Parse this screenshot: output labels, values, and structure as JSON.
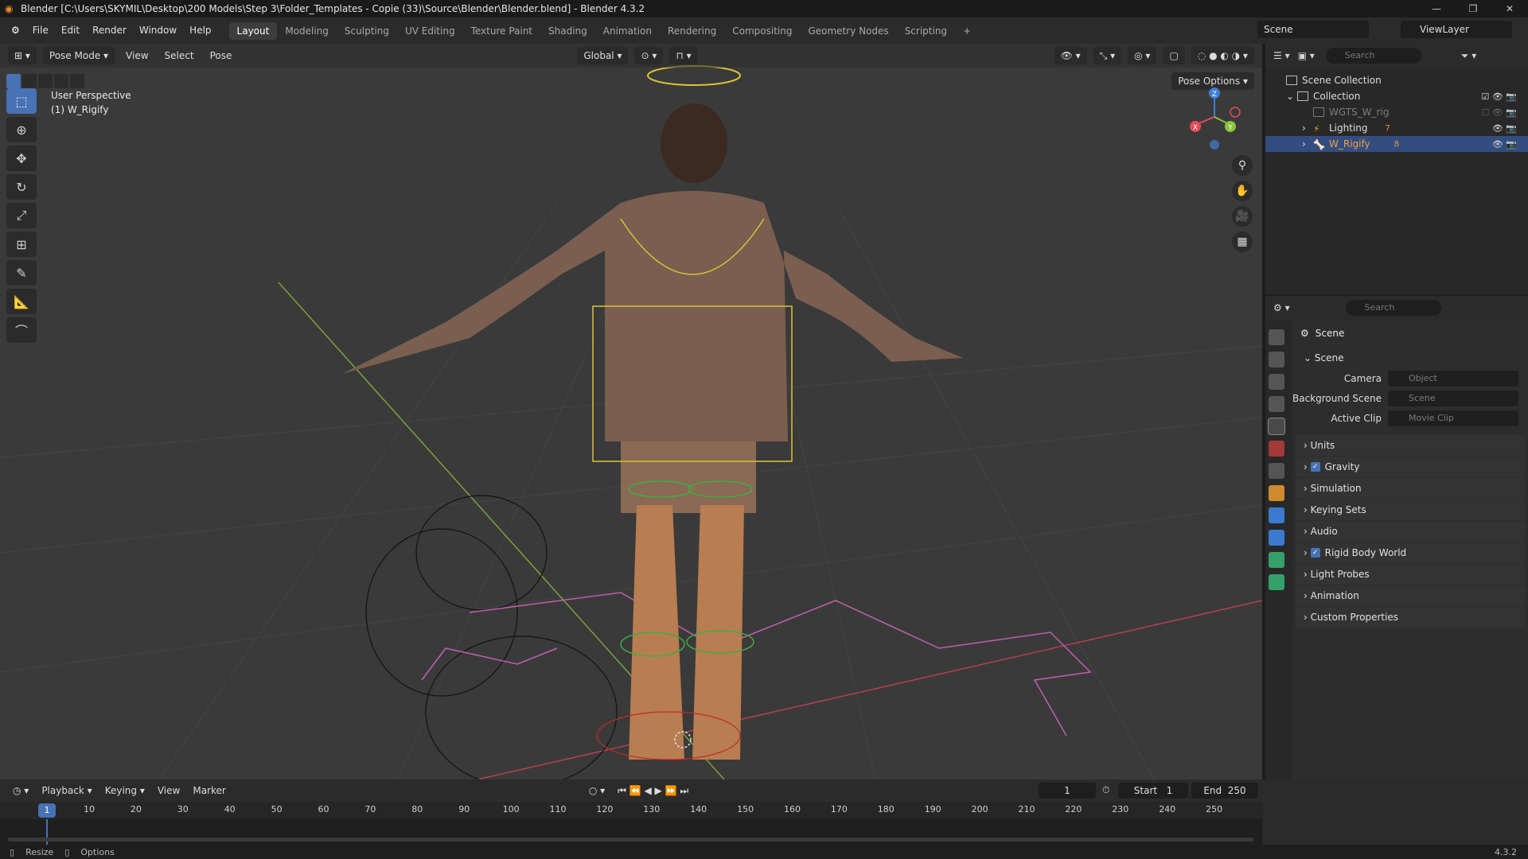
{
  "window": {
    "title": "Blender [C:\\Users\\SKYMIL\\Desktop\\200 Models\\Step 3\\Folder_Templates - Copie (33)\\Source\\Blender\\Blender.blend] - Blender 4.3.2"
  },
  "menu": [
    "File",
    "Edit",
    "Render",
    "Window",
    "Help"
  ],
  "workspaces": [
    "Layout",
    "Modeling",
    "Sculpting",
    "UV Editing",
    "Texture Paint",
    "Shading",
    "Animation",
    "Rendering",
    "Compositing",
    "Geometry Nodes",
    "Scripting"
  ],
  "active_workspace": "Layout",
  "scene_selector": "Scene",
  "viewlayer_selector": "ViewLayer",
  "viewport": {
    "mode": "Pose Mode",
    "menus": [
      "View",
      "Select",
      "Pose"
    ],
    "transform_orientation": "Global",
    "overlay_line1": "User Perspective",
    "overlay_line2": "(1) W_Rigify",
    "pose_options": "Pose Options",
    "gizmo": {
      "x": "X",
      "y": "Y",
      "z": "Z"
    }
  },
  "outliner": {
    "search_placeholder": "Search",
    "rows": [
      {
        "label": "Scene Collection"
      },
      {
        "label": "Collection"
      },
      {
        "label": "WGTS_W_rig"
      },
      {
        "label": "Lighting",
        "badge": "7"
      },
      {
        "label": "W_Rigify",
        "badge": "8"
      }
    ]
  },
  "properties": {
    "search_placeholder": "Search",
    "context_title": "Scene",
    "panel_scene": "Scene",
    "fields": [
      {
        "label": "Camera",
        "value": "Object"
      },
      {
        "label": "Background Scene",
        "value": "Scene"
      },
      {
        "label": "Active Clip",
        "value": "Movie Clip"
      }
    ],
    "panels": [
      {
        "label": "Units",
        "checked": false
      },
      {
        "label": "Gravity",
        "checked": true
      },
      {
        "label": "Simulation",
        "checked": false
      },
      {
        "label": "Keying Sets",
        "checked": false
      },
      {
        "label": "Audio",
        "checked": false
      },
      {
        "label": "Rigid Body World",
        "checked": true
      },
      {
        "label": "Light Probes",
        "checked": false
      },
      {
        "label": "Animation",
        "checked": false
      },
      {
        "label": "Custom Properties",
        "checked": false
      }
    ]
  },
  "timeline": {
    "menus": [
      "Playback",
      "Keying",
      "View",
      "Marker"
    ],
    "current_frame": "1",
    "start_label": "Start",
    "start": "1",
    "end_label": "End",
    "end": "250",
    "ticks": [
      "10",
      "20",
      "30",
      "40",
      "50",
      "60",
      "70",
      "80",
      "90",
      "100",
      "110",
      "120",
      "130",
      "140",
      "150",
      "160",
      "170",
      "180",
      "190",
      "200",
      "210",
      "220",
      "230",
      "240",
      "250"
    ]
  },
  "status": {
    "left1": "Resize",
    "left2": "Options",
    "version": "4.3.2"
  },
  "colors": {
    "accent": "#4772b3",
    "selection_row": "#334d80",
    "x_axis": "#e24b5a",
    "y_axis": "#8bc43c",
    "z_axis": "#3d7fd6"
  }
}
